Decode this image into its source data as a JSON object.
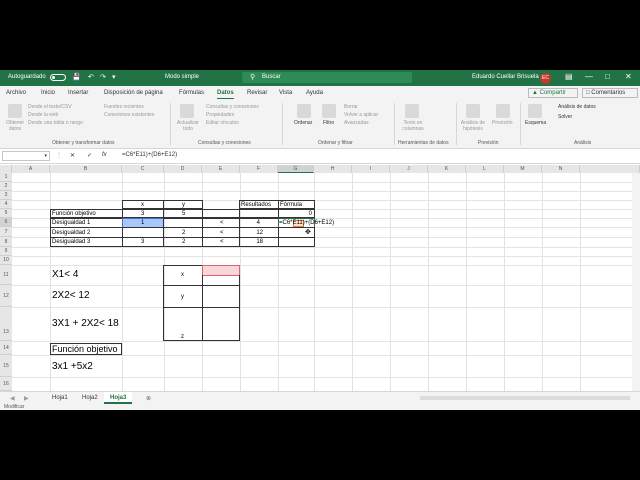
{
  "titlebar": {
    "autosave_label": "Autoguardado",
    "mode_label": "Modo simple",
    "search_placeholder": "Buscar",
    "user_name": "Eduardo Cuellar Brisuela",
    "user_initials": "EC"
  },
  "menu": {
    "tabs": [
      "Archivo",
      "Inicio",
      "Insertar",
      "Disposición de página",
      "Fórmulas",
      "Datos",
      "Revisar",
      "Vista",
      "Ayuda"
    ],
    "active": "Datos",
    "share_label": "Compartir",
    "comments_label": "Comentarios"
  },
  "ribbon": {
    "get_data": "Obtener datos",
    "from_text": "Desde el texto/CSV",
    "from_web": "Desde la web",
    "from_table": "Desde una tabla o rango",
    "recent_sources": "Fuentes recientes",
    "existing_connections": "Conexiones existentes",
    "group_get_transform": "Obtener y transformar datos",
    "refresh_all": "Actualizar todo",
    "queries_connections": "Consultas y conexiones",
    "properties": "Propiedades",
    "edit_links": "Editar vínculos",
    "group_queries": "Consultas y conexiones",
    "sort": "Ordenar",
    "filter": "Filtro",
    "clear": "Borrar",
    "reapply": "Volver a aplicar",
    "advanced": "Avanzadas",
    "group_sort_filter": "Ordenar y filtrar",
    "text_to_columns": "Texto en columnas",
    "group_data_tools": "Herramientas de datos",
    "what_if": "Análisis de hipótesis",
    "forecast_sheet": "Previsión",
    "group_forecast": "Previsión",
    "outline": "Esquema",
    "data_analysis": "Análisis de datos",
    "solver": "Solver",
    "group_analysis": "Análisis"
  },
  "formula_bar": {
    "formula": "=C6*E11)+(D6+E12)"
  },
  "grid": {
    "columns": [
      "A",
      "B",
      "C",
      "D",
      "E",
      "F",
      "G",
      "H",
      "I",
      "J",
      "K",
      "L",
      "M",
      "N"
    ],
    "rows": [
      "1",
      "2",
      "3",
      "4",
      "5",
      "6",
      "7",
      "8",
      "9",
      "10",
      "11",
      "12",
      "13",
      "14",
      "15",
      "16"
    ],
    "cells": {
      "C4": "x",
      "D4": "y",
      "F4": "Resultados",
      "G4": "Fórmula",
      "B5": "Función objetivo",
      "C5": "3",
      "D5": "5",
      "G5": "0",
      "B6": "Desigualdad 1",
      "C6": "1",
      "E6": "<",
      "F6": "4",
      "G6": "=C6*E11)+(D6+E12)",
      "B7": "Desigualdad 2",
      "D7": "2",
      "E7": "<",
      "F7": "12",
      "B8": "Desigualdad 3",
      "C8": "3",
      "D8": "2",
      "E8": "<",
      "F8": "18",
      "B11": "X1< 4",
      "B12": "2X2< 12",
      "B13": "3X1 + 2X2< 18",
      "B14": "Función objetivo",
      "B15": "3x1 +5x2",
      "D11": "x",
      "D12": "y",
      "D13": "z"
    }
  },
  "sheets": {
    "tabs": [
      "Hoja1",
      "Hoja2",
      "Hoja3"
    ],
    "active": "Hoja3"
  },
  "status": {
    "mode": "Modificar"
  }
}
